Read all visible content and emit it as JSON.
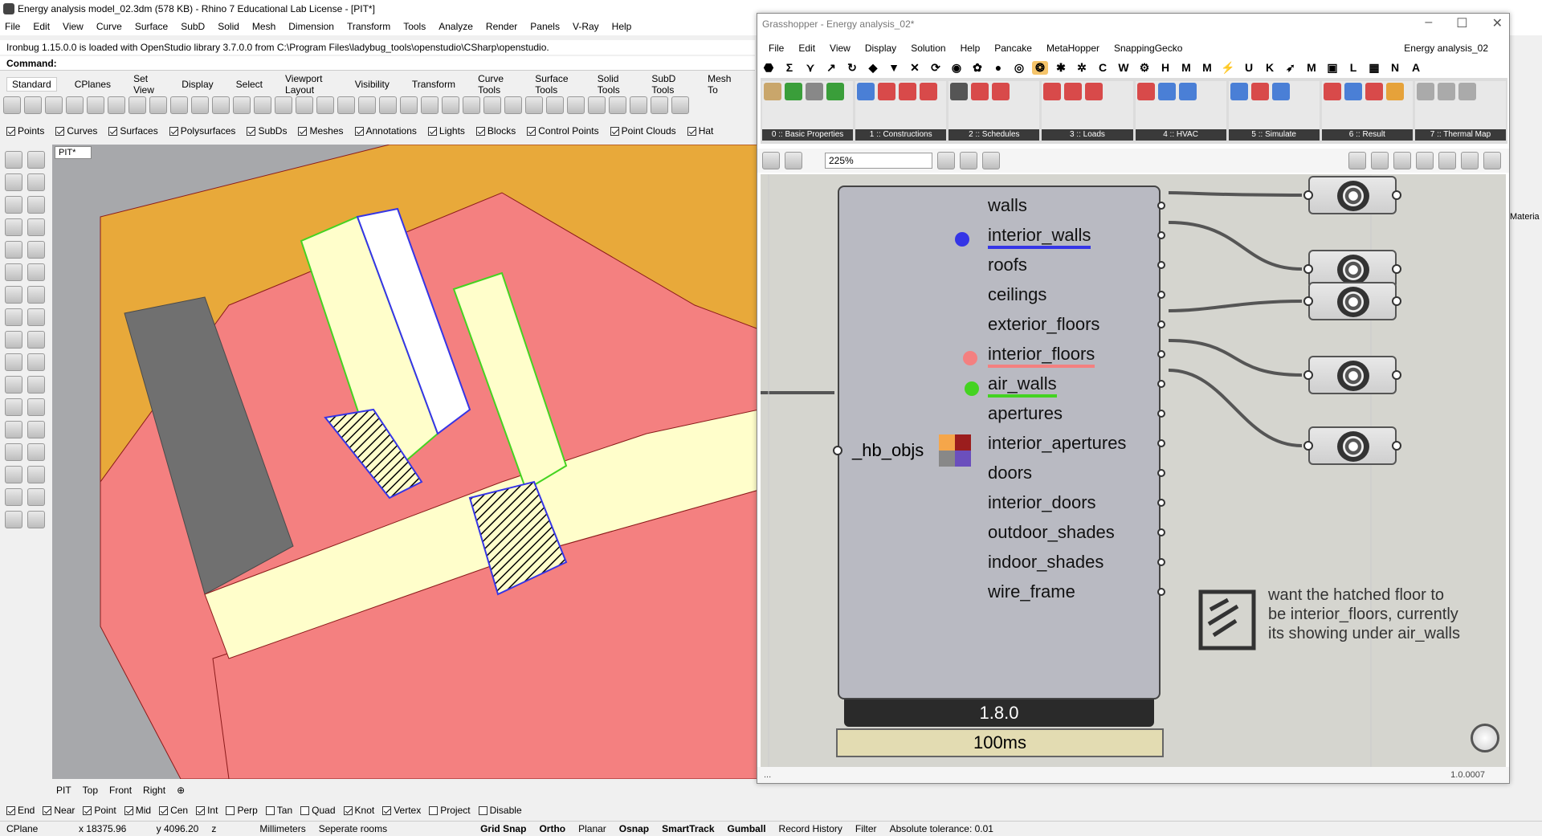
{
  "rhino": {
    "title": "Energy analysis model_02.3dm (578 KB) - Rhino 7 Educational Lab License - [PIT*]",
    "menu": [
      "File",
      "Edit",
      "View",
      "Curve",
      "Surface",
      "SubD",
      "Solid",
      "Mesh",
      "Dimension",
      "Transform",
      "Tools",
      "Analyze",
      "Render",
      "Panels",
      "V-Ray",
      "Help"
    ],
    "command_history": "Ironbug 1.15.0.0 is loaded with OpenStudio library 3.7.0.0 from C:\\Program Files\\ladybug_tools\\openstudio\\CSharp\\openstudio.",
    "command_label": "Command:",
    "toolbar_tabs": [
      "Standard",
      "CPlanes",
      "Set View",
      "Display",
      "Select",
      "Viewport Layout",
      "Visibility",
      "Transform",
      "Curve Tools",
      "Surface Tools",
      "Solid Tools",
      "SubD Tools",
      "Mesh To"
    ],
    "filters": [
      {
        "label": "Points",
        "checked": true
      },
      {
        "label": "Curves",
        "checked": true
      },
      {
        "label": "Surfaces",
        "checked": true
      },
      {
        "label": "Polysurfaces",
        "checked": true
      },
      {
        "label": "SubDs",
        "checked": true
      },
      {
        "label": "Meshes",
        "checked": true
      },
      {
        "label": "Annotations",
        "checked": true
      },
      {
        "label": "Lights",
        "checked": true
      },
      {
        "label": "Blocks",
        "checked": true
      },
      {
        "label": "Control Points",
        "checked": true
      },
      {
        "label": "Point Clouds",
        "checked": true
      },
      {
        "label": "Hat",
        "checked": true
      }
    ],
    "viewport_label": "PIT*",
    "viewport_tabs": [
      "PIT",
      "Top",
      "Front",
      "Right"
    ],
    "osnaps": [
      {
        "label": "End",
        "checked": true
      },
      {
        "label": "Near",
        "checked": true
      },
      {
        "label": "Point",
        "checked": true
      },
      {
        "label": "Mid",
        "checked": true
      },
      {
        "label": "Cen",
        "checked": true
      },
      {
        "label": "Int",
        "checked": true
      },
      {
        "label": "Perp",
        "checked": false
      },
      {
        "label": "Tan",
        "checked": false
      },
      {
        "label": "Quad",
        "checked": false
      },
      {
        "label": "Knot",
        "checked": true
      },
      {
        "label": "Vertex",
        "checked": true
      },
      {
        "label": "Project",
        "checked": false
      },
      {
        "label": "Disable",
        "checked": false
      }
    ],
    "status": {
      "cplane": "CPlane",
      "x": "x 18375.96",
      "y": "y 4096.20",
      "z": "z",
      "units": "Millimeters",
      "layer": "Seperate rooms",
      "grid_snap": "Grid Snap",
      "ortho": "Ortho",
      "planar": "Planar",
      "osnap": "Osnap",
      "smarttrack": "SmartTrack",
      "gumball": "Gumball",
      "record_history": "Record History",
      "filter": "Filter",
      "tolerance": "Absolute tolerance: 0.01"
    }
  },
  "grasshopper": {
    "title": "Grasshopper - Energy analysis_02*",
    "menu": [
      "File",
      "Edit",
      "View",
      "Display",
      "Solution",
      "Help",
      "Pancake",
      "MetaHopper",
      "SnappingGecko"
    ],
    "doc_name": "Energy analysis_02",
    "tab_letters": [
      "C",
      "W",
      "H",
      "M",
      "M",
      "U",
      "K",
      "M",
      "L",
      "N",
      "A"
    ],
    "ribbon_groups": [
      "0 :: Basic Properties",
      "1 :: Constructions",
      "2 :: Schedules",
      "3 :: Loads",
      "4 :: HVAC",
      "5 :: Simulate",
      "6 :: Result",
      "7 :: Thermal Map"
    ],
    "zoom": "225%",
    "component": {
      "input": "_hb_objs",
      "outputs": [
        "walls",
        "interior_walls",
        "roofs",
        "ceilings",
        "exterior_floors",
        "interior_floors",
        "air_walls",
        "apertures",
        "interior_apertures",
        "doors",
        "interior_doors",
        "outdoor_shades",
        "indoor_shades",
        "wire_frame"
      ],
      "version": "1.8.0",
      "time": "100ms"
    },
    "note": "want the hatched floor to be interior_floors, currently its showing under air_walls",
    "bottom_status": "...",
    "version_label": "1.0.0007"
  },
  "right_panel_label": "Materia",
  "colors": {
    "blue": "#3535e6",
    "red": "#f46d6d",
    "green": "#44d321",
    "orange": "#e8a93a",
    "pink": "#f48080",
    "cream": "#fffecb"
  }
}
